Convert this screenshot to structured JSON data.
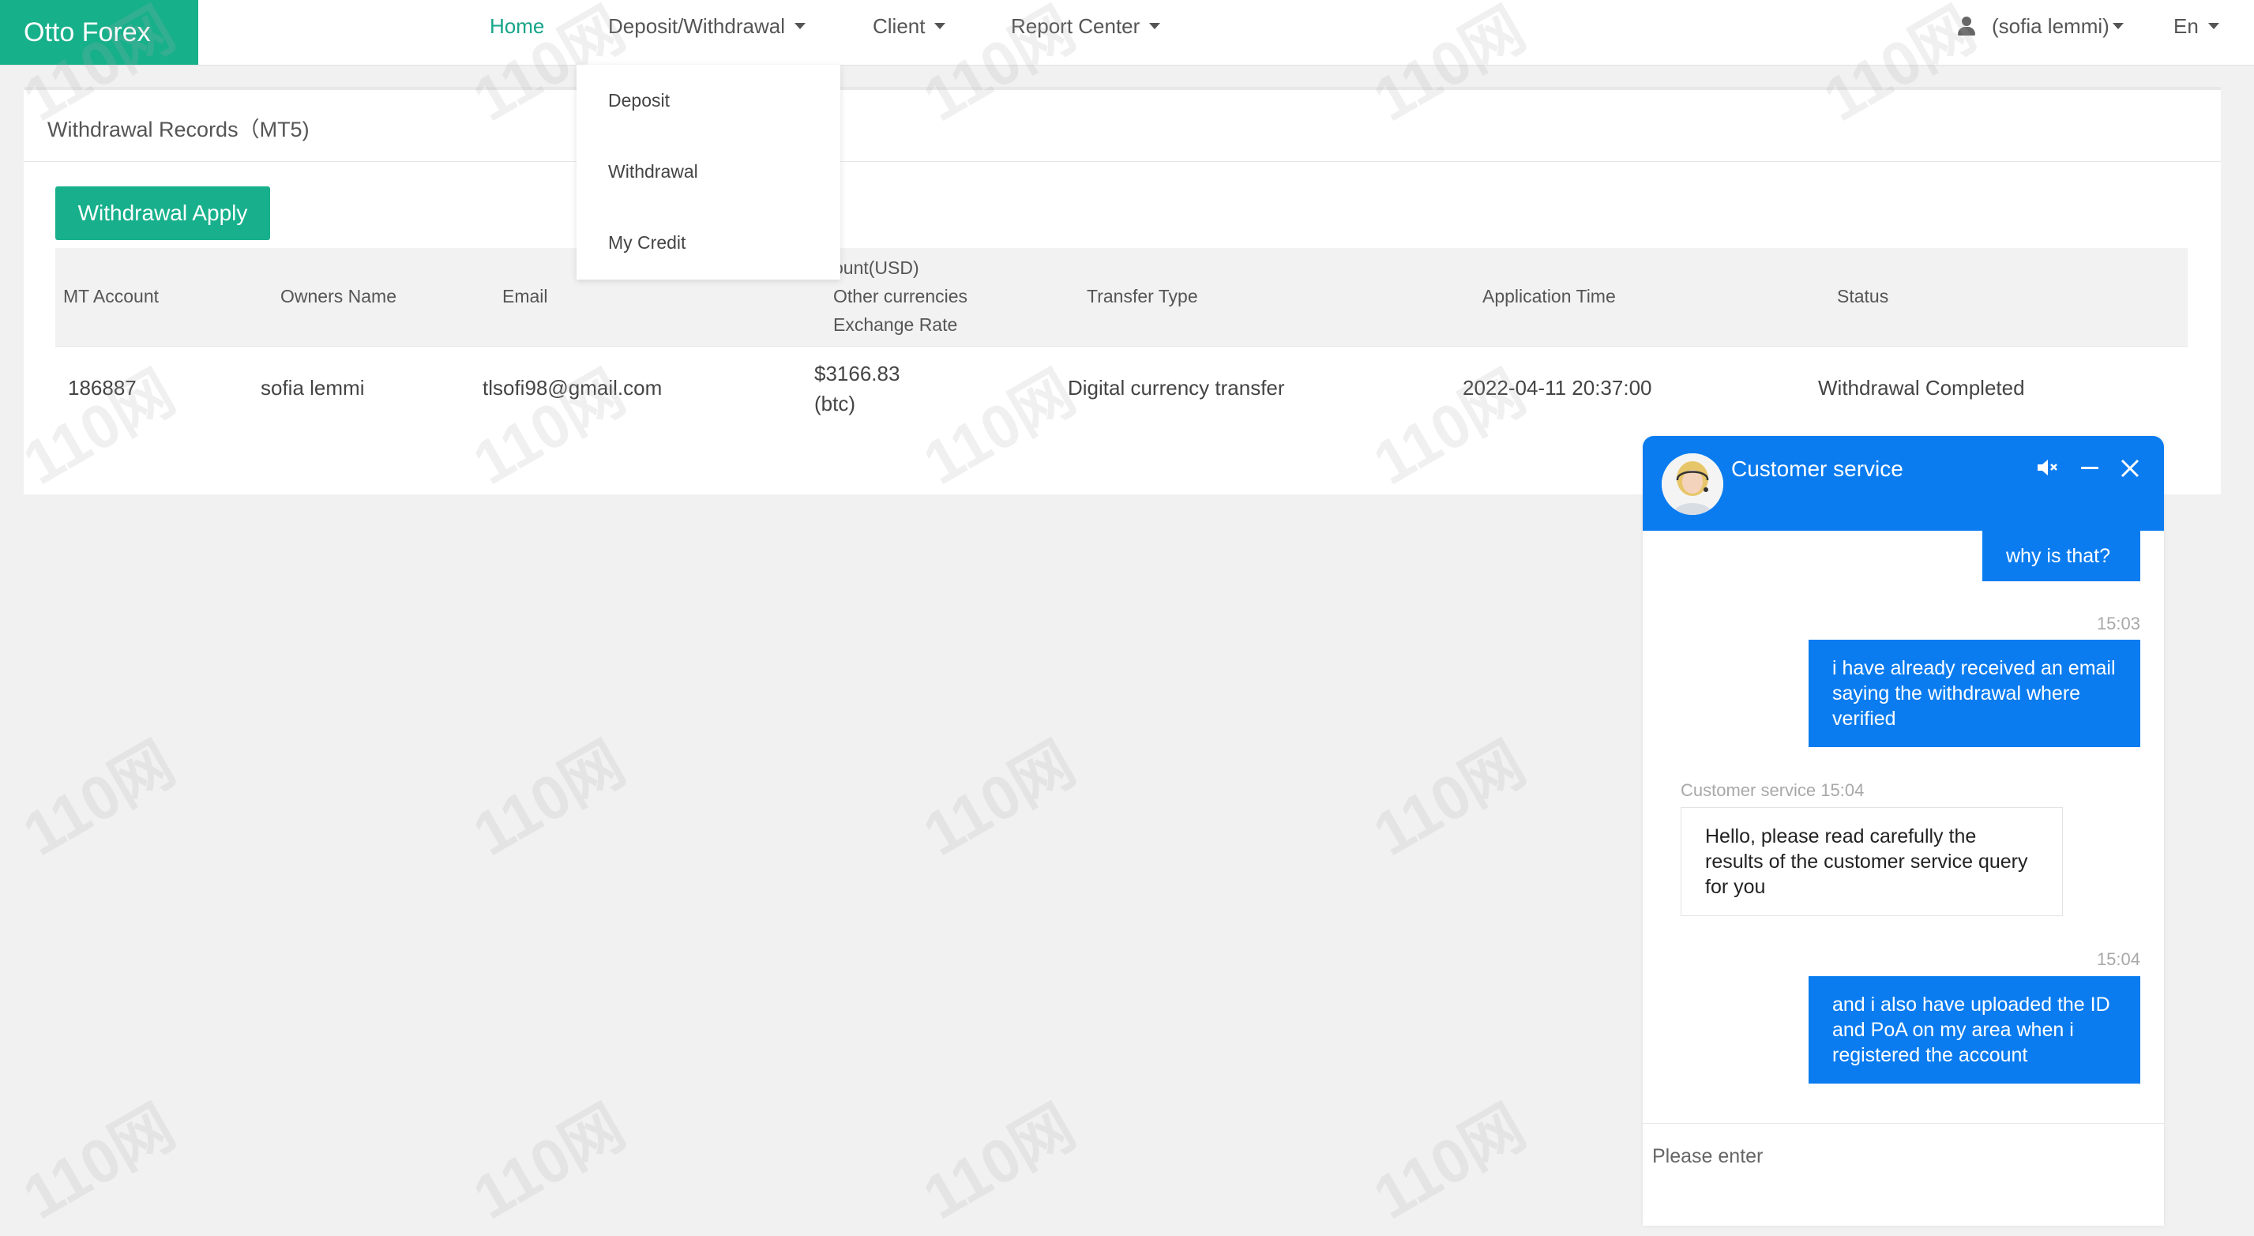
{
  "nav": {
    "brand": "Otto Forex",
    "home": "Home",
    "deposit_withdrawal": "Deposit/Withdrawal",
    "client": "Client",
    "report_center": "Report Center",
    "user": "(sofia lemmi)",
    "language": "En"
  },
  "dropdown": {
    "items": [
      "Deposit",
      "Withdrawal",
      "My Credit"
    ]
  },
  "page": {
    "title": "Withdrawal Records（MT5)",
    "apply_button": "Withdrawal Apply"
  },
  "table": {
    "headers": {
      "mt_account": "MT Account",
      "owners_name": "Owners Name",
      "email": "Email",
      "amount_line1": "ount(USD)",
      "amount_line2": "Other currencies",
      "amount_line3": "Exchange Rate",
      "transfer_type": "Transfer Type",
      "application_time": "Application Time",
      "status": "Status"
    },
    "rows": [
      {
        "mt_account": "186887",
        "owners_name": "sofia lemmi",
        "email": "tlsofi98@gmail.com",
        "amount": "$3166.83",
        "currency": "(btc)",
        "transfer_type": "Digital currency transfer",
        "application_time": "2022-04-11 20:37:00",
        "status": "Withdrawal Completed"
      }
    ]
  },
  "chat": {
    "title": "Customer service",
    "messages": [
      {
        "from": "user",
        "text": "why is that?"
      },
      {
        "from": "user",
        "time": "15:03",
        "text": "i have already received an email saying the withdrawal where verified"
      },
      {
        "from": "agent",
        "time": "Customer service 15:04",
        "text": "Hello, please read carefully the results of the customer service query for you"
      },
      {
        "from": "user",
        "time": "15:04",
        "text": "and i also have uploaded the ID and PoA on my area when i registered the account"
      }
    ],
    "input_placeholder": "Please enter"
  },
  "watermark": "110网",
  "colors": {
    "brand_green": "#16b08a",
    "chat_blue": "#0a7cf0",
    "nav_active": "#16a589"
  }
}
